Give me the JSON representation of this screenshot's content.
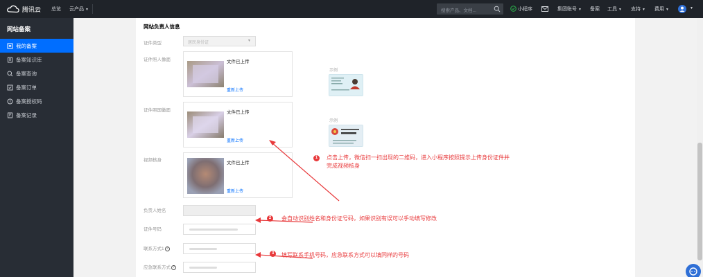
{
  "topbar": {
    "brand": "腾讯云",
    "nav": {
      "overview": "总览",
      "products": "云产品"
    },
    "search_placeholder": "搜索产品、文档...",
    "right": {
      "mini_program": "小程序",
      "group_account": "集团账号",
      "beian": "备案",
      "tools": "工具",
      "support": "支持",
      "billing": "费用"
    }
  },
  "sidebar": {
    "title": "网站备案",
    "items": [
      {
        "label": "我的备案",
        "icon": "doc-icon"
      },
      {
        "label": "备案知识库",
        "icon": "book-icon"
      },
      {
        "label": "备案查询",
        "icon": "search-icon"
      },
      {
        "label": "备案订单",
        "icon": "order-icon"
      },
      {
        "label": "备案授权码",
        "icon": "key-icon"
      },
      {
        "label": "备案记录",
        "icon": "record-icon"
      }
    ]
  },
  "form": {
    "section_title": "网站负责人信息",
    "id_type_label": "证件类型",
    "id_type_value": "居民身份证",
    "id_front_label": "证件照人像面",
    "id_back_label": "证件照国徽面",
    "video_label": "视频核身",
    "upload_status": "文件已上传",
    "reupload": "重新上传",
    "name_label": "负责人姓名",
    "id_number_label": "证件号码",
    "phone_label": "联系方式1",
    "emergency_label": "应急联系方式",
    "example_label": "示例"
  },
  "annotations": [
    {
      "num": "1",
      "text_line1": "点击上传，微信扫一扫出现的二维码，进入小程序按照提示上传身份证件并",
      "text_line2": "完成视频核身"
    },
    {
      "num": "2",
      "text": "会自动识别姓名和身份证号码，如果识别有误可以手动填写修改"
    },
    {
      "num": "3",
      "text": "填写联系手机号码，应急联系方式可以填同样的号码"
    }
  ],
  "colors": {
    "accent": "#006eff",
    "annotation": "#e8393b",
    "sidebar_bg": "#282d35",
    "topbar_bg": "#1f2329"
  }
}
